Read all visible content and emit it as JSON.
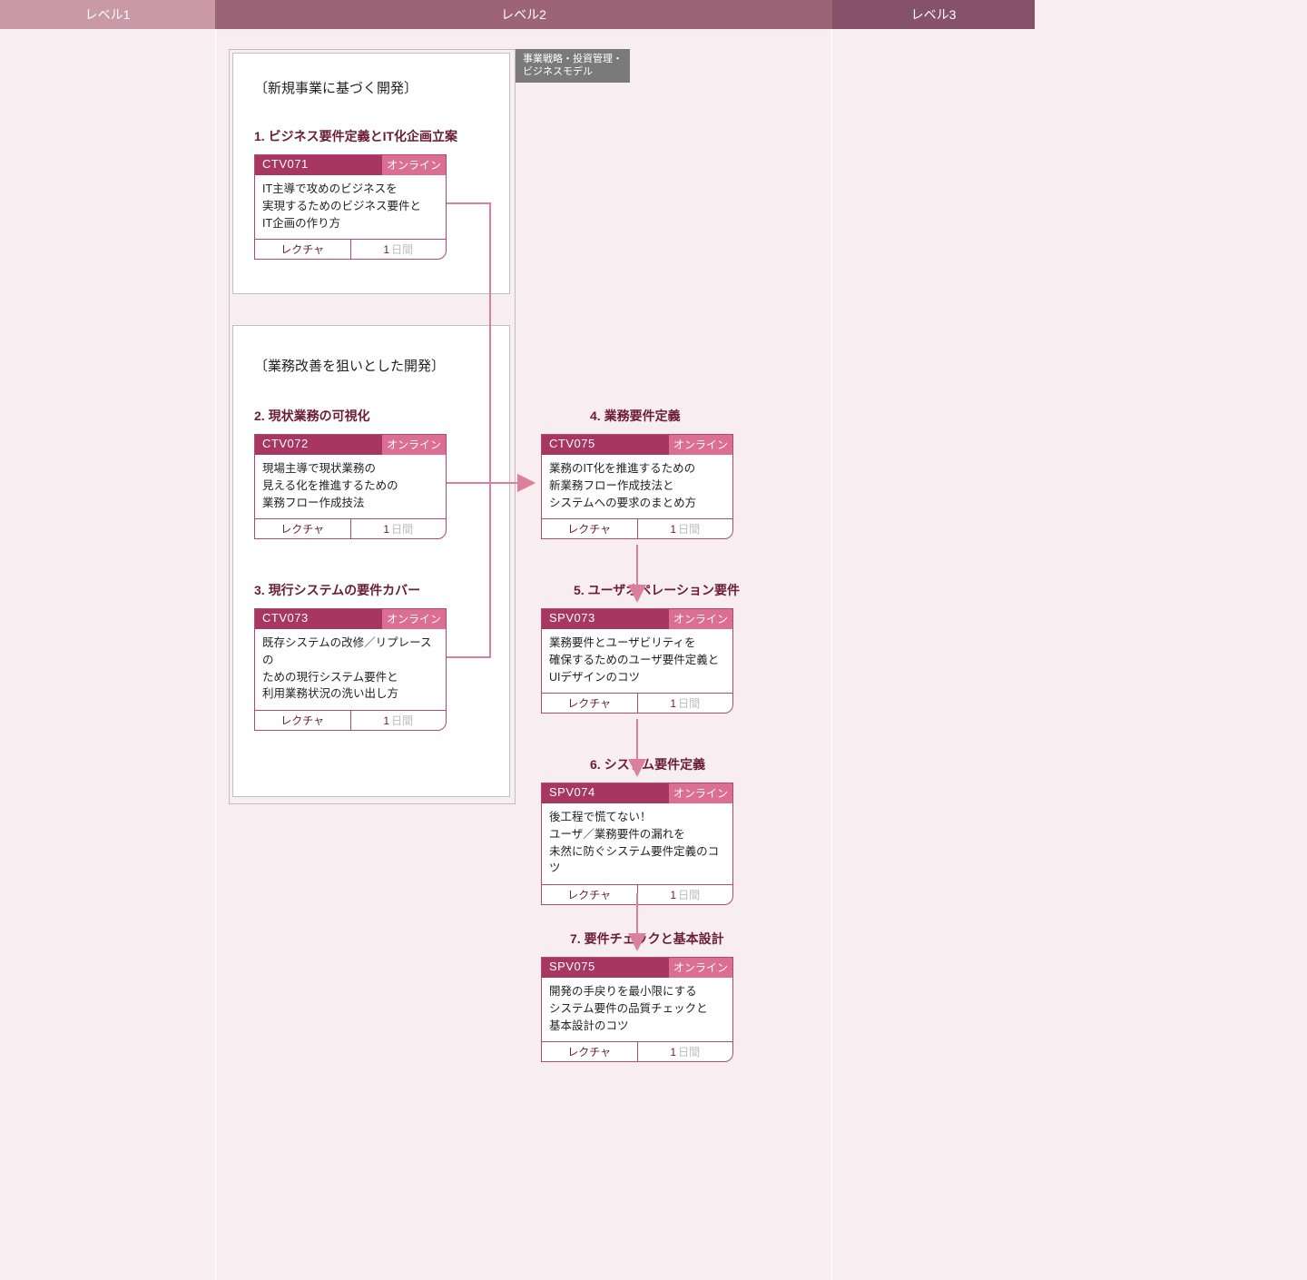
{
  "levels": {
    "l1": "レベル1",
    "l2": "レベル2",
    "l3": "レベル3"
  },
  "panel_label_line1": "事業戦略・投資管理・",
  "panel_label_line2": "ビジネスモデル",
  "group1_title": "〔新規事業に基づく開発〕",
  "group2_title": "〔業務改善を狙いとした開発〕",
  "steps": {
    "s1": "1. ビジネス要件定義とIT化企画立案",
    "s2": "2. 現状業務の可視化",
    "s3": "3. 現行システムの要件カバー",
    "s4": "4. 業務要件定義",
    "s5": "5. ユーザオペレーション要件",
    "s6": "6. システム要件定義",
    "s7": "7. 要件チェックと基本設計"
  },
  "cards": {
    "c1": {
      "code": "CTV071",
      "badge": "オンライン",
      "body": "IT主導で攻めのビジネスを\n実現するためのビジネス要件と\nIT企画の作り方",
      "type": "レクチャ",
      "days": "1",
      "unit": "日間"
    },
    "c2": {
      "code": "CTV072",
      "badge": "オンライン",
      "body": "現場主導で現状業務の\n見える化を推進するための\n業務フロー作成技法",
      "type": "レクチャ",
      "days": "1",
      "unit": "日間"
    },
    "c3": {
      "code": "CTV073",
      "badge": "オンライン",
      "body": "既存システムの改修／リプレースの\nための現行システム要件と\n利用業務状況の洗い出し方",
      "type": "レクチャ",
      "days": "1",
      "unit": "日間"
    },
    "c4": {
      "code": "CTV075",
      "badge": "オンライン",
      "body": "業務のIT化を推進するための\n新業務フロー作成技法と\nシステムへの要求のまとめ方",
      "type": "レクチャ",
      "days": "1",
      "unit": "日間"
    },
    "c5": {
      "code": "SPV073",
      "badge": "オンライン",
      "body": "業務要件とユーザビリティを\n確保するためのユーザ要件定義と\nUIデザインのコツ",
      "type": "レクチャ",
      "days": "1",
      "unit": "日間"
    },
    "c6": {
      "code": "SPV074",
      "badge": "オンライン",
      "body": "後工程で慌てない！\nユーザ／業務要件の漏れを\n未然に防ぐシステム要件定義のコツ",
      "type": "レクチャ",
      "days": "1",
      "unit": "日間"
    },
    "c7": {
      "code": "SPV075",
      "badge": "オンライン",
      "body": "開発の手戻りを最小限にする\nシステム要件の品質チェックと\n基本設計のコツ",
      "type": "レクチャ",
      "days": "1",
      "unit": "日間"
    }
  }
}
